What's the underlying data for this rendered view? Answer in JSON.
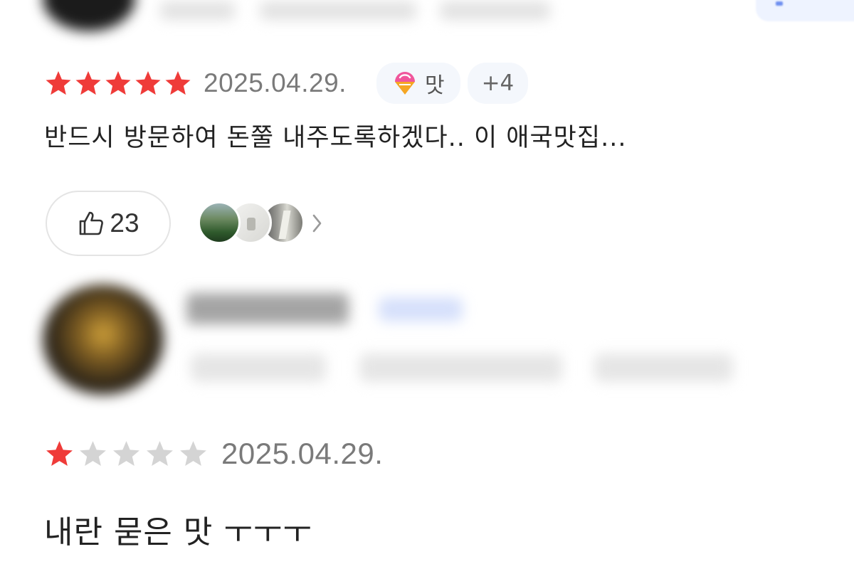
{
  "reviews": [
    {
      "rating": 5,
      "date": "2025.04.29.",
      "tag_label": "맛",
      "tag_icon": "taste-tag-icon",
      "more_tags": "+4",
      "text": "반드시 방문하여 돈쭐 내주도록하겠다.. 이 애국맛집...",
      "likes": "23",
      "photo_count": 3
    },
    {
      "rating": 1,
      "date": "2025.04.29.",
      "text": "내란 묻은 맛 ㅜㅜㅜ"
    }
  ],
  "colors": {
    "star_filled": "#ef3b39",
    "star_empty": "#d4d4d4",
    "date_text": "#7a7a7a",
    "chip_bg": "#f4f7fc"
  }
}
